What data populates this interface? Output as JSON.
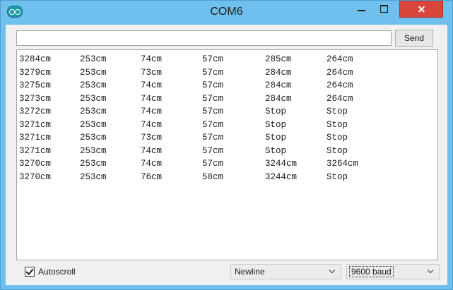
{
  "window": {
    "title": "COM6"
  },
  "input": {
    "value": "",
    "send_label": "Send"
  },
  "output": {
    "rows": [
      [
        "3284cm",
        "253cm",
        "74cm",
        "57cm",
        "285cm",
        "264cm"
      ],
      [
        "3279cm",
        "253cm",
        "73cm",
        "57cm",
        "284cm",
        "264cm"
      ],
      [
        "3275cm",
        "253cm",
        "74cm",
        "57cm",
        "284cm",
        "264cm"
      ],
      [
        "3273cm",
        "253cm",
        "74cm",
        "57cm",
        "284cm",
        "264cm"
      ],
      [
        "3272cm",
        "253cm",
        "74cm",
        "57cm",
        "Stop",
        "Stop"
      ],
      [
        "3271cm",
        "253cm",
        "74cm",
        "57cm",
        "Stop",
        "Stop"
      ],
      [
        "3271cm",
        "253cm",
        "73cm",
        "57cm",
        "Stop",
        "Stop"
      ],
      [
        "3271cm",
        "253cm",
        "74cm",
        "57cm",
        "Stop",
        "Stop"
      ],
      [
        "3270cm",
        "253cm",
        "74cm",
        "57cm",
        "3244cm",
        "3264cm"
      ],
      [
        "3270cm",
        "253cm",
        "76cm",
        "58cm",
        "3244cm",
        "Stop"
      ]
    ]
  },
  "footer": {
    "autoscroll_label": "Autoscroll",
    "autoscroll_checked": true,
    "line_ending": "Newline",
    "baud_rate": "9600 baud"
  },
  "colors": {
    "title_bar": "#6fc0ef",
    "close_button": "#d9463b",
    "panel": "#f0f0f0"
  }
}
